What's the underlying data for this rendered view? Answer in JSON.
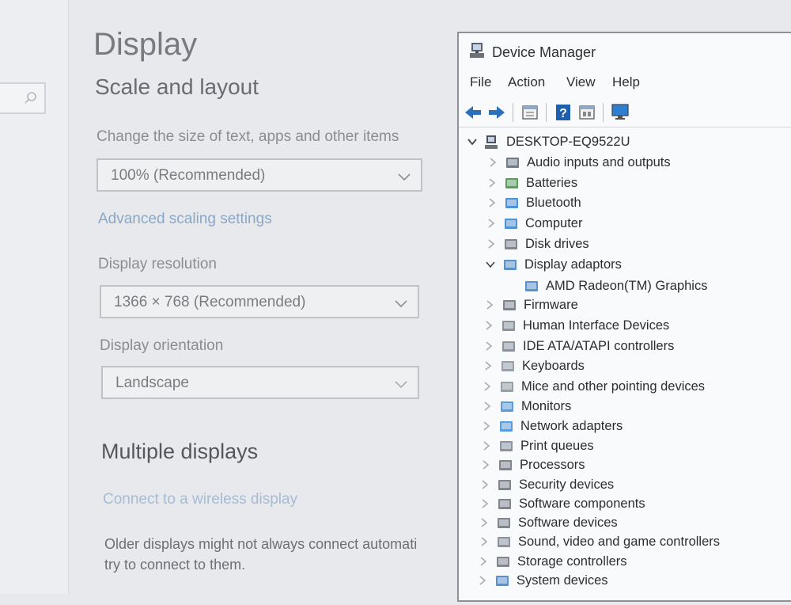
{
  "settings": {
    "page_title": "Display",
    "section_title": "Scale and layout",
    "scale": {
      "label": "Change the size of text, apps and other items",
      "value": "100% (Recommended)"
    },
    "advanced_link": "Advanced scaling settings",
    "resolution": {
      "label": "Display resolution",
      "value": "1366 × 768 (Recommended)"
    },
    "orientation": {
      "label": "Display orientation",
      "value": "Landscape"
    },
    "multiple_title": "Multiple displays",
    "wireless_link": "Connect to a wireless display",
    "older_text_line1": "Older displays might not always connect automati",
    "older_text_line2": "try to connect to them."
  },
  "device_manager": {
    "title": "Device Manager",
    "menu": [
      "File",
      "Action",
      "View",
      "Help"
    ],
    "computer_name": "DESKTOP-EQ9522U",
    "categories": [
      {
        "label": "Audio inputs and outputs",
        "icon": "speaker-icon"
      },
      {
        "label": "Batteries",
        "icon": "battery-icon"
      },
      {
        "label": "Bluetooth",
        "icon": "bluetooth-icon"
      },
      {
        "label": "Computer",
        "icon": "computer-icon"
      },
      {
        "label": "Disk drives",
        "icon": "disk-drive-icon"
      },
      {
        "label": "Display adaptors",
        "icon": "display-adapter-icon"
      },
      {
        "label": "AMD Radeon(TM) Graphics",
        "icon": "display-adapter-icon"
      },
      {
        "label": "Firmware",
        "icon": "firmware-icon"
      },
      {
        "label": "Human Interface Devices",
        "icon": "hid-icon"
      },
      {
        "label": "IDE ATA/ATAPI controllers",
        "icon": "ide-controller-icon"
      },
      {
        "label": "Keyboards",
        "icon": "keyboard-icon"
      },
      {
        "label": "Mice and other pointing devices",
        "icon": "mouse-icon"
      },
      {
        "label": "Monitors",
        "icon": "monitor-icon"
      },
      {
        "label": "Network adapters",
        "icon": "network-icon"
      },
      {
        "label": "Print queues",
        "icon": "printer-icon"
      },
      {
        "label": "Processors",
        "icon": "processor-icon"
      },
      {
        "label": "Security devices",
        "icon": "security-icon"
      },
      {
        "label": "Software components",
        "icon": "software-component-icon"
      },
      {
        "label": "Software devices",
        "icon": "software-device-icon"
      },
      {
        "label": "Sound, video and game controllers",
        "icon": "sound-icon"
      },
      {
        "label": "Storage controllers",
        "icon": "storage-icon"
      },
      {
        "label": "System devices",
        "icon": "system-icon"
      }
    ]
  },
  "colors": {
    "link": "#8ba7c6",
    "window_border": "#8d9096",
    "accent_blue": "#2f7fd0"
  }
}
